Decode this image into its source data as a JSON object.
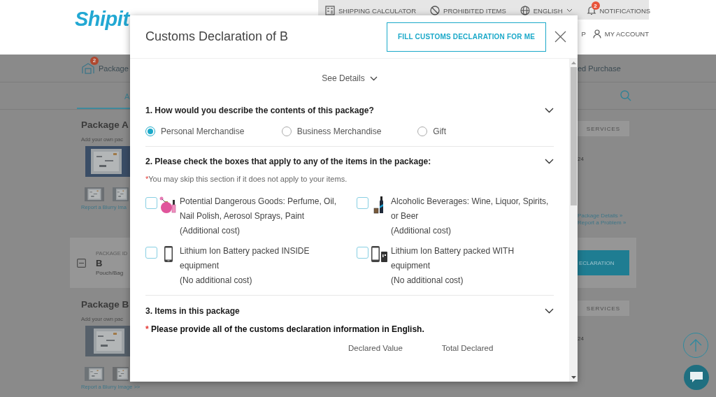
{
  "header": {
    "logo": "Shipit",
    "top_links": [
      {
        "kind": "calculator",
        "label": "SHIPPING CALCULATOR"
      },
      {
        "kind": "prohibited",
        "label": "PROHIBITED ITEMS"
      },
      {
        "kind": "language",
        "label": "ENGLISH"
      },
      {
        "kind": "notifications",
        "label": "NOTIFICATIONS",
        "badge": "2"
      }
    ],
    "account_links": [
      {
        "kind": "plain",
        "label": "P"
      },
      {
        "kind": "account",
        "label": "MY ACCOUNT"
      }
    ]
  },
  "background": {
    "nav_left": {
      "label": "Package",
      "badge": "2"
    },
    "nav_right": "ed Purchase",
    "tab_left": "A",
    "cards": [
      {
        "title": "Package A",
        "hint": "Add your own pac",
        "report": "Report a Blurry Ima"
      },
      {
        "title": "Package B",
        "hint": "Add your own pac",
        "report": "Report a Blurry Image >>"
      }
    ],
    "package_row": {
      "id_label": "PACKAGE ID",
      "id": "B",
      "type": "Pouch/Bag"
    },
    "right_cards": [
      {
        "services": "SERVICES",
        "date": "24",
        "links": [
          "Package Details »",
          "Report a Problem »"
        ]
      },
      {
        "services": "SERVICES",
        "date": "24"
      }
    ],
    "declaration_button": "ECLARATION"
  },
  "modal": {
    "title": "Customs Declaration of B",
    "fill_button": "FILL CUSTOMS DECLARATION FOR ME",
    "see_details": "See Details",
    "sections": [
      {
        "kind": "radios",
        "heading": "1. How would you describe the contents of this package?",
        "options": [
          {
            "label": "Personal Merchandise",
            "selected": true
          },
          {
            "label": "Business Merchandise",
            "selected": false
          },
          {
            "label": "Gift",
            "selected": false
          }
        ]
      },
      {
        "kind": "checkboxes",
        "heading": "2. Please check the boxes that apply to any of the items in the package:",
        "note_mark": "*",
        "note": "You may skip this section if it does not apply to your items.",
        "items": [
          {
            "kind": "perfume",
            "text": "Potential Dangerous Goods: Perfume, Oil, Nail Polish, Aerosol Sprays, Paint",
            "cost": "(Additional cost)",
            "checked": false
          },
          {
            "kind": "alcohol",
            "text": "Alcoholic Beverages: Wine, Liquor, Spirits, or Beer",
            "cost": "(Additional cost)",
            "checked": false
          },
          {
            "kind": "phone",
            "text": "Lithium Ion Battery packed INSIDE equipment",
            "cost": "(No additional cost)",
            "checked": false
          },
          {
            "kind": "phone_battery",
            "text": "Lithium Ion Battery packed WITH equipment",
            "cost": "(No additional cost)",
            "checked": false
          }
        ]
      },
      {
        "kind": "items",
        "heading": "3. Items in this package",
        "required_mark": "*",
        "required": "Please provide all of the customs declaration information in English.",
        "columns": [
          "Declared Value",
          "Total Declared"
        ]
      }
    ]
  }
}
